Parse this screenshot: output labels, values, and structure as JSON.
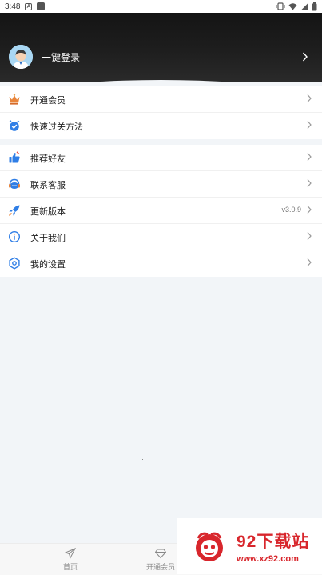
{
  "status_bar": {
    "time": "3:48",
    "badge": "A"
  },
  "header": {
    "login_label": "一键登录"
  },
  "menu_group_1": [
    {
      "label": "开通会员",
      "icon": "crown-icon"
    },
    {
      "label": "快速过关方法",
      "icon": "alarm-check-icon"
    }
  ],
  "menu_group_2": [
    {
      "label": "推荐好友",
      "icon": "thumbs-up-icon"
    },
    {
      "label": "联系客服",
      "icon": "headset-icon"
    },
    {
      "label": "更新版本",
      "icon": "rocket-icon",
      "value": "v3.0.9"
    },
    {
      "label": "关于我们",
      "icon": "info-icon"
    },
    {
      "label": "我的设置",
      "icon": "settings-icon"
    }
  ],
  "tabbar": [
    {
      "label": "首页",
      "icon": "paper-plane-icon"
    },
    {
      "label": "开通会员",
      "icon": "diamond-icon"
    }
  ],
  "watermark": {
    "title": "92下载站",
    "url": "www.xz92.com"
  },
  "colors": {
    "accent_blue": "#2f7ee6",
    "crown_orange": "#e8843a",
    "watermark_red": "#d8262c"
  }
}
